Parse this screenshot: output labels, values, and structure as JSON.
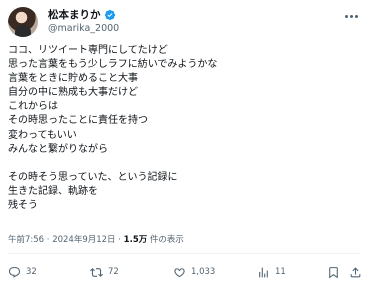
{
  "author": {
    "display_name": "松本まりか",
    "handle": "@marika_2000",
    "verified_color": "#1d9bf0"
  },
  "tweet": {
    "lines": [
      "ココ、リツイート専門にしてたけど",
      "思った言葉をもう少しラフに紡いでみようかな",
      "言葉をときに貯めること大事",
      "自分の中に熟成も大事だけど",
      "これからは",
      "その時思ったことに責任を持つ",
      "変わってもいい",
      "みんなと繋がりながら",
      "",
      "その時そう思っていた、という記録に",
      "生きた記録、軌跡を",
      "残そう"
    ],
    "time": "午前7:56",
    "separator": " · ",
    "date": "2024年9月12日",
    "views_count": "1.5万",
    "views_label": " 件の表示"
  },
  "actions": {
    "reply_count": "32",
    "retweet_count": "72",
    "like_count": "1,033",
    "views_count": "11"
  },
  "icons": {
    "more": "more-options-icon",
    "verified": "verified-badge-icon",
    "reply": "reply-icon",
    "retweet": "retweet-icon",
    "like": "heart-icon",
    "views": "views-bar-chart-icon",
    "bookmark": "bookmark-icon",
    "share": "share-icon"
  }
}
